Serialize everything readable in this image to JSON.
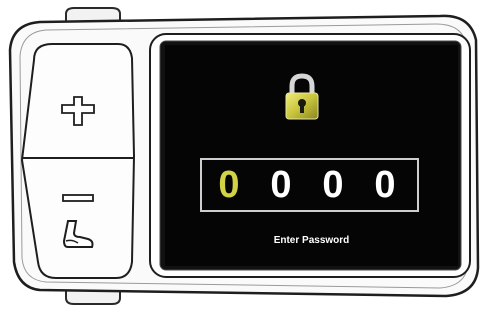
{
  "controls": {
    "plus_button": "plus-icon",
    "minus_button": "minus-icon",
    "walk_assist_icon": "boot-icon"
  },
  "screen": {
    "lock_icon": "padlock-icon",
    "password_digits": [
      "0",
      "0",
      "0",
      "0"
    ],
    "active_digit_index": 0,
    "prompt": "Enter Password"
  },
  "colors": {
    "screen_background": "#050505",
    "active_digit": "#d2d246",
    "digit": "#ffffff",
    "lock_gold": "#c8c43c"
  }
}
